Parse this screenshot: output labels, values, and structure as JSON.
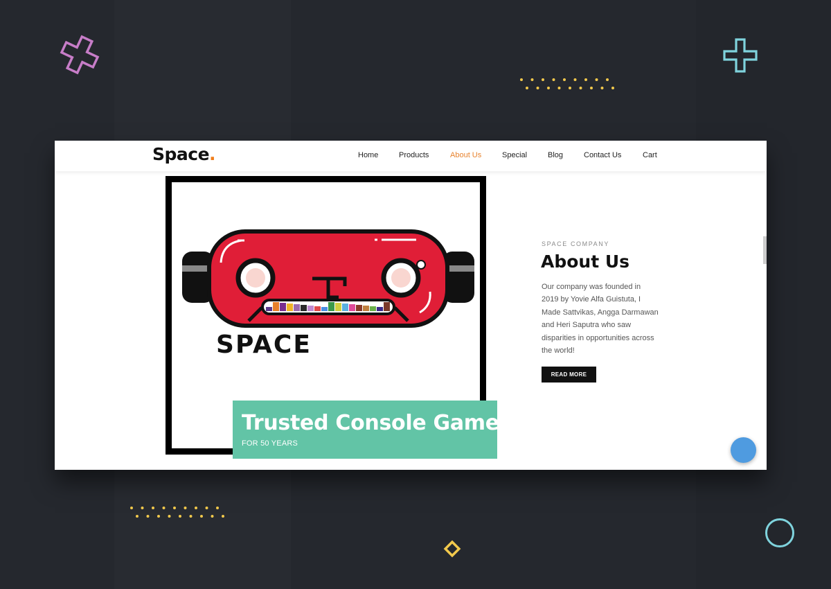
{
  "brand": {
    "name": "Space",
    "dot": ".",
    "accent_color": "#f07d1a"
  },
  "nav": {
    "items": [
      {
        "label": "Home",
        "active": false
      },
      {
        "label": "Products",
        "active": false
      },
      {
        "label": "About Us",
        "active": true
      },
      {
        "label": "Special",
        "active": false
      },
      {
        "label": "Blog",
        "active": false
      },
      {
        "label": "Contact Us",
        "active": false
      },
      {
        "label": "Cart",
        "active": false
      }
    ],
    "active_color": "#e8822d"
  },
  "hero": {
    "logo_text": "SPACE",
    "badge_title": "Trusted Console Game",
    "badge_subtitle": "FOR 50 YEARS",
    "badge_color": "#62c4a6"
  },
  "about": {
    "eyebrow": "SPACE COMPANY",
    "title": "About Us",
    "body": "Our company was founded in 2019 by Yovie Alfa Guistuta, I Made Sattvikas, Angga Darmawan and Heri Saputra who saw disparities in opportunities across the world!",
    "cta_label": "READ MORE"
  },
  "decorations": {
    "background": "#25282e",
    "plus_pink": "#c77dc8",
    "plus_cyan": "#7fd3dd",
    "dots_yellow": "#f2c94c",
    "diamond_yellow": "#f2c94c",
    "ring_cyan": "#7fd3dd",
    "fab_color": "#4f9be0"
  }
}
